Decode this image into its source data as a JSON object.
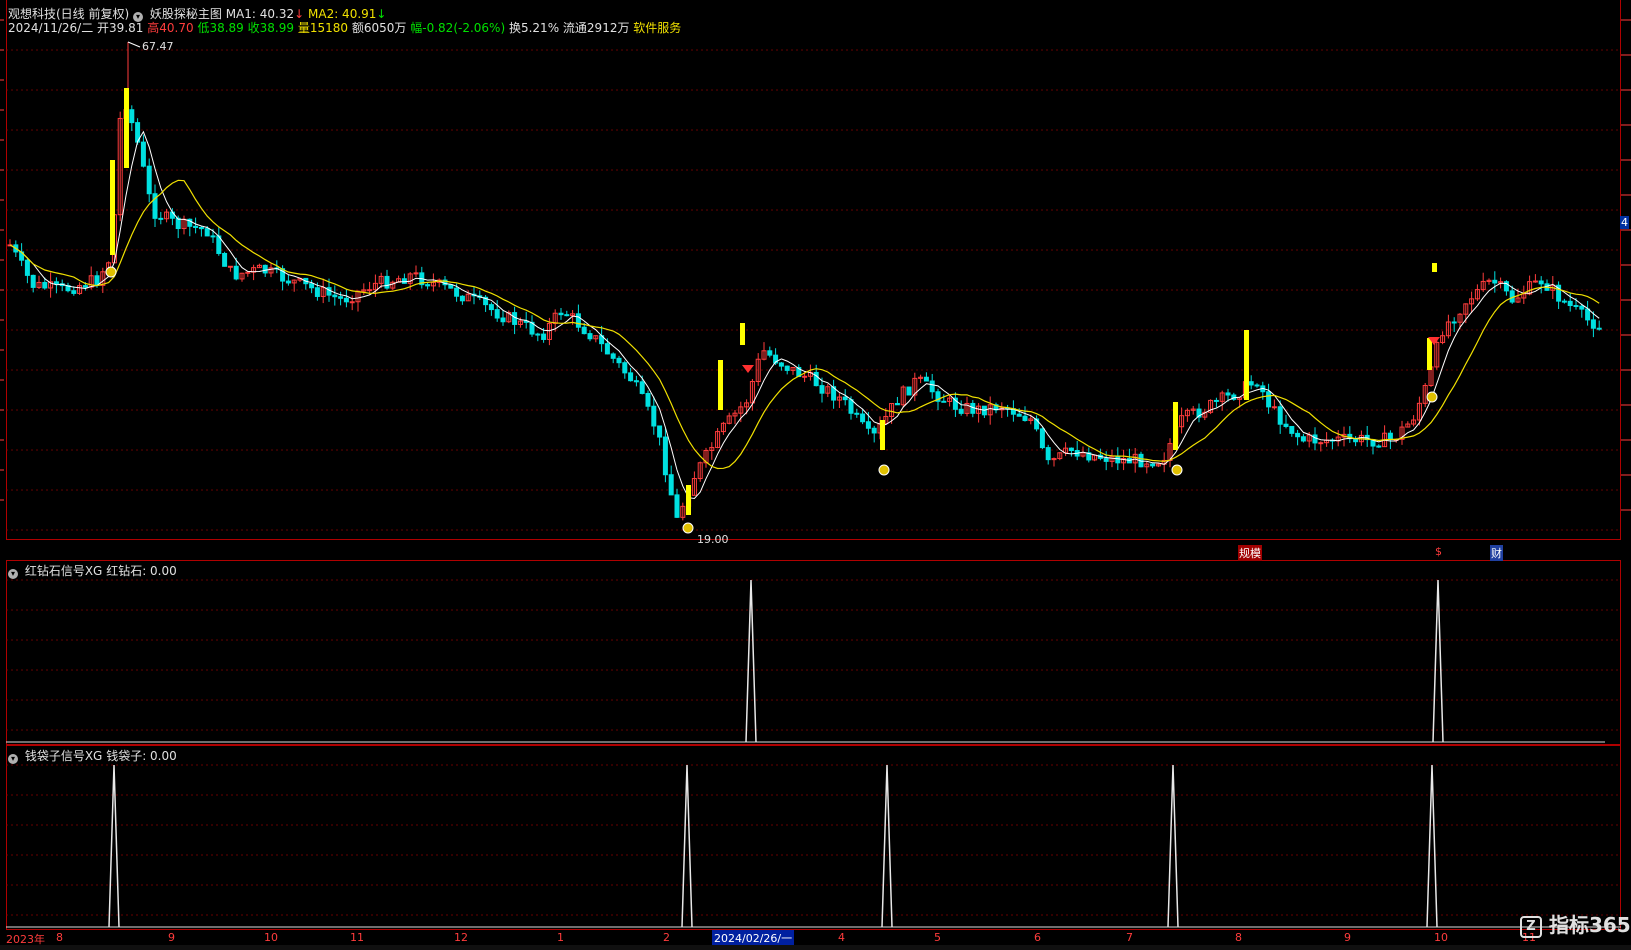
{
  "header": {
    "title": "观想科技(日线 前复权)",
    "indicator_name": "妖股探秘主图",
    "ma1": "MA1: 40.32",
    "ma2": "MA2: 40.91",
    "date": "2024/11/26/二",
    "open": "开39.81",
    "high_label": "高",
    "high": "40.70",
    "low_label": "低",
    "low": "38.89",
    "close_label": "收",
    "close": "38.99",
    "vol_label": "量",
    "vol": "15180",
    "amount": "额6050万",
    "change_label": "幅",
    "change": "-0.82(-2.06%)",
    "turnover": "换5.21%",
    "float": "流通2912万",
    "sector": "软件服务"
  },
  "price_marks": {
    "max_label": "67.47",
    "min_label": "19.00"
  },
  "event_tags": {
    "tag1": "规模",
    "tag2": "$",
    "tag3": "财"
  },
  "panel2": {
    "name": "红钻石信号XG",
    "value": "红钻石: 0.00"
  },
  "panel3": {
    "name": "钱袋子信号XG",
    "value": "钱袋子: 0.00"
  },
  "x_axis": {
    "labels": [
      "2023年",
      "8",
      "9",
      "10",
      "11",
      "12",
      "1",
      "2",
      "2024/02/26/一",
      "4",
      "5",
      "6",
      "7",
      "8",
      "9",
      "10",
      "11"
    ]
  },
  "right_marker": "4",
  "watermark": "指标365",
  "colors": {
    "up": "#ff3c3c",
    "down": "#00e0e0",
    "ma1": "#ffffff",
    "ma2": "#f0e000",
    "signal": "#ffff00",
    "grid": "#8b0000"
  },
  "chart_data": {
    "type": "candlestick",
    "price_extremes": {
      "max": 67.47,
      "min": 19.0
    },
    "red_diamond_signal_indices": [
      95,
      254
    ],
    "money_bag_signal_indices": [
      14,
      88,
      115,
      153,
      188
    ]
  }
}
